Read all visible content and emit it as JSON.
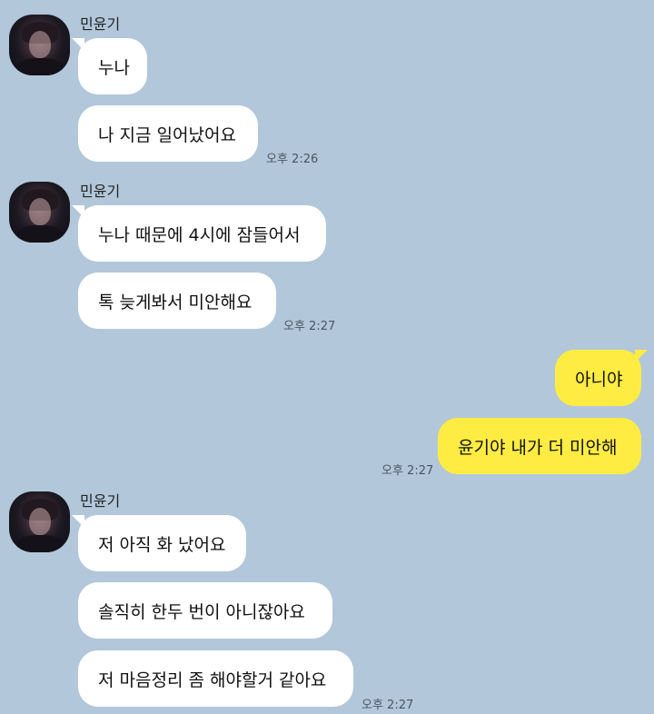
{
  "contact": {
    "name": "민윤기"
  },
  "colors": {
    "background": "#b2c7da",
    "incoming_bubble": "#ffffff",
    "outgoing_bubble": "#ffec42"
  },
  "groups": [
    {
      "sender": "민윤기",
      "messages": [
        "누나",
        "나 지금 일어났어요"
      ],
      "time": "오후 2:26"
    },
    {
      "sender": "민윤기",
      "messages": [
        "누나 때문에 4시에 잠들어서",
        "톡 늦게봐서 미안해요"
      ],
      "time": "오후 2:27"
    },
    {
      "sender": "me",
      "messages": [
        "아니야",
        "윤기야 내가 더 미안해"
      ],
      "time": "오후 2:27"
    },
    {
      "sender": "민윤기",
      "messages": [
        "저 아직 화 났어요",
        "솔직히 한두 번이 아니잖아요",
        "저 마음정리 좀 해야할거 같아요"
      ],
      "time": "오후 2:27"
    }
  ]
}
